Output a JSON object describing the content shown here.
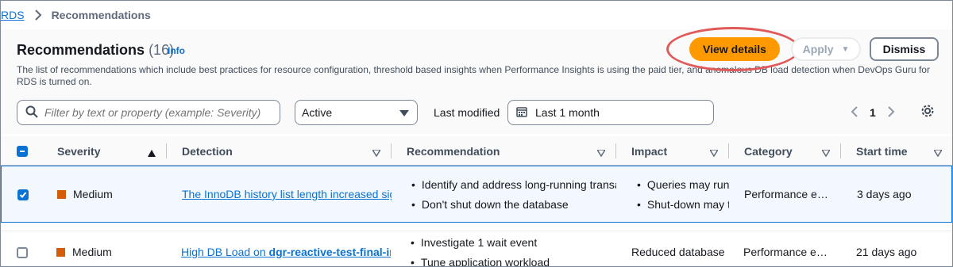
{
  "breadcrumb": {
    "root": "RDS",
    "current": "Recommendations"
  },
  "header": {
    "title": "Recommendations",
    "count": "(16)",
    "info": "Info",
    "description": "The list of recommendations which include best practices for resource configuration, threshold based insights when Performance Insights is using the paid tier, and anomalous DB load detection when DevOps Guru for RDS is turned on."
  },
  "actions": {
    "view_details": "View details",
    "apply": "Apply",
    "dismiss": "Dismiss"
  },
  "filters": {
    "search_placeholder": "Filter by text or property (example: Severity)",
    "status_selected": "Active",
    "last_modified_label": "Last modified",
    "date_range": "Last 1 month"
  },
  "pagination": {
    "current_page": "1"
  },
  "table": {
    "columns": [
      "Severity",
      "Detection",
      "Recommendation",
      "Impact",
      "Category",
      "Start time"
    ],
    "rows": [
      {
        "selected": true,
        "severity": "Medium",
        "detection": "The InnoDB history list length increased significantly",
        "recommendations": [
          "Identify and address long-running transactions",
          "Don't shut down the database"
        ],
        "impacts": [
          "Queries may run slower",
          "Shut-down may take longer"
        ],
        "category": "Performance e…",
        "start_time": "3 days ago"
      },
      {
        "selected": false,
        "severity": "Medium",
        "detection_prefix": "High DB Load on ",
        "detection_bold": "dgr-reactive-test-final-instance",
        "recommendations": [
          "Investigate 1 wait event",
          "Tune application workload"
        ],
        "impact": "Reduced database performance",
        "category": "Performance e…",
        "start_time": "21 days ago"
      }
    ]
  },
  "colors": {
    "primary": "#ff9900",
    "link": "#0972d3",
    "severity_medium": "#d45b07",
    "highlight": "#e05a5a"
  }
}
